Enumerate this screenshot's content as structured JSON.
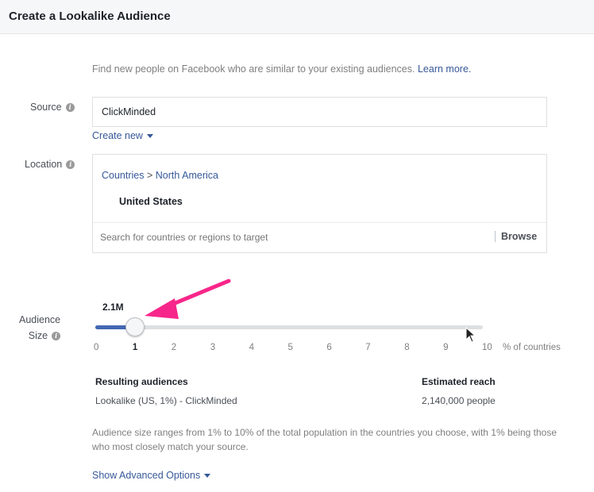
{
  "header": {
    "title": "Create a Lookalike Audience"
  },
  "intro": {
    "text": "Find new people on Facebook who are similar to your existing audiences.",
    "link": "Learn more."
  },
  "source": {
    "label": "Source",
    "value": "ClickMinded",
    "create_new": "Create new"
  },
  "location": {
    "label": "Location",
    "breadcrumb_root": "Countries",
    "breadcrumb_sep": ">",
    "breadcrumb_region": "North America",
    "selected_country": "United States",
    "search_placeholder": "Search for countries or regions to target",
    "browse_label": "Browse"
  },
  "audience_size": {
    "label_line1": "Audience",
    "label_line2": "Size",
    "value_display": "2.1M",
    "slider_value": 1,
    "slider_min": 0,
    "slider_max": 10,
    "ticks": [
      "0",
      "1",
      "2",
      "3",
      "4",
      "5",
      "6",
      "7",
      "8",
      "9",
      "10"
    ],
    "unit": "% of countries"
  },
  "results": {
    "col1_header": "Resulting audiences",
    "col1_value": "Lookalike (US, 1%) - ClickMinded",
    "col2_header": "Estimated reach",
    "col2_value": "2,140,000 people"
  },
  "note": "Audience size ranges from 1% to 10% of the total population in the countries you choose, with 1% being those who most closely match your source.",
  "advanced": "Show Advanced Options",
  "colors": {
    "accent": "#4267b2",
    "link": "#365899",
    "annotation_arrow": "#f7268a"
  }
}
